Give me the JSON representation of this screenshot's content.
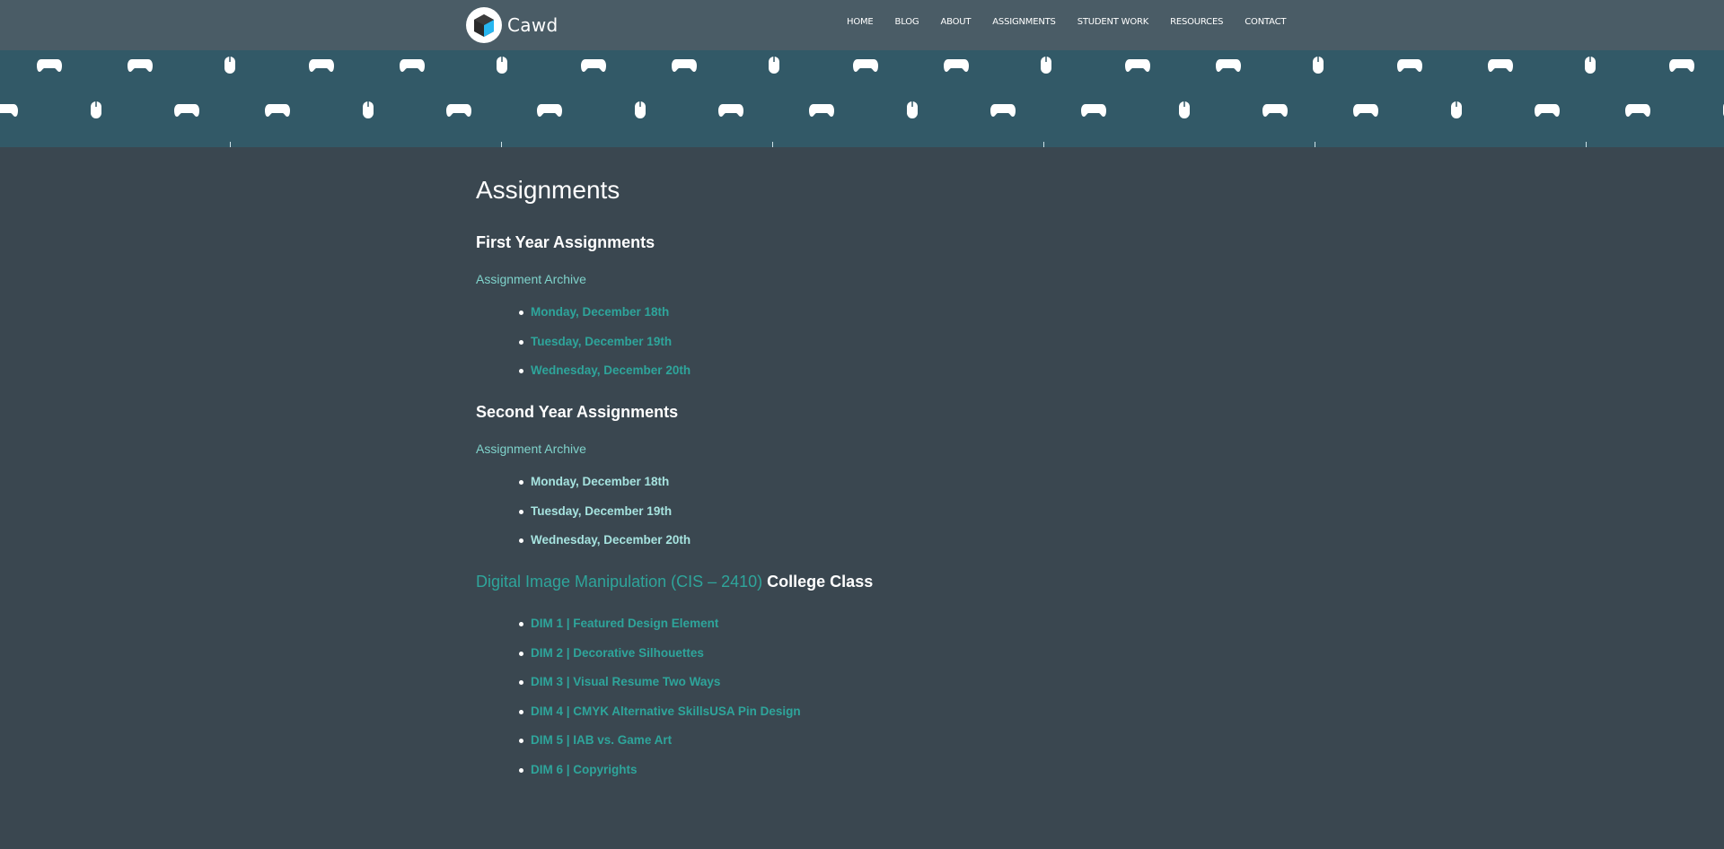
{
  "site": {
    "name": "Cawd",
    "logo_icon": "cube-logo-icon"
  },
  "nav": {
    "items": [
      {
        "label": "HOME"
      },
      {
        "label": "BLOG"
      },
      {
        "label": "ABOUT"
      },
      {
        "label": "ASSIGNMENTS"
      },
      {
        "label": "STUDENT WORK"
      },
      {
        "label": "RESOURCES"
      },
      {
        "label": "CONTACT"
      }
    ]
  },
  "banner": {
    "pattern_icons": [
      "game-controller-icon",
      "computer-mouse-icon"
    ]
  },
  "page": {
    "title": "Assignments"
  },
  "first_year": {
    "heading": "First Year Assignments",
    "archive_label": "Assignment Archive",
    "items": [
      "Monday, December 18th",
      "Tuesday, December 19th",
      "Wednesday, December 20th"
    ]
  },
  "second_year": {
    "heading": "Second Year Assignments",
    "archive_label": "Assignment Archive",
    "items": [
      "Monday, December 18th",
      "Tuesday, December 19th",
      "Wednesday, December 20th"
    ]
  },
  "college_class": {
    "link_label": "Digital Image Manipulation (CIS – 2410)",
    "suffix": " College Class",
    "items": [
      "DIM 1 | Featured Design Element",
      "DIM 2 | Decorative Silhouettes",
      "DIM 3 | Visual Resume Two Ways",
      "DIM 4 | CMYK Alternative SkillsUSA Pin Design",
      "DIM 5 | IAB vs. Game Art",
      "DIM 6 | Copyrights"
    ]
  },
  "colors": {
    "background": "#3a4750",
    "header": "#4a5c66",
    "banner": "#325967",
    "link_teal": "#2ea59b",
    "link_mint": "#a6e3df"
  }
}
